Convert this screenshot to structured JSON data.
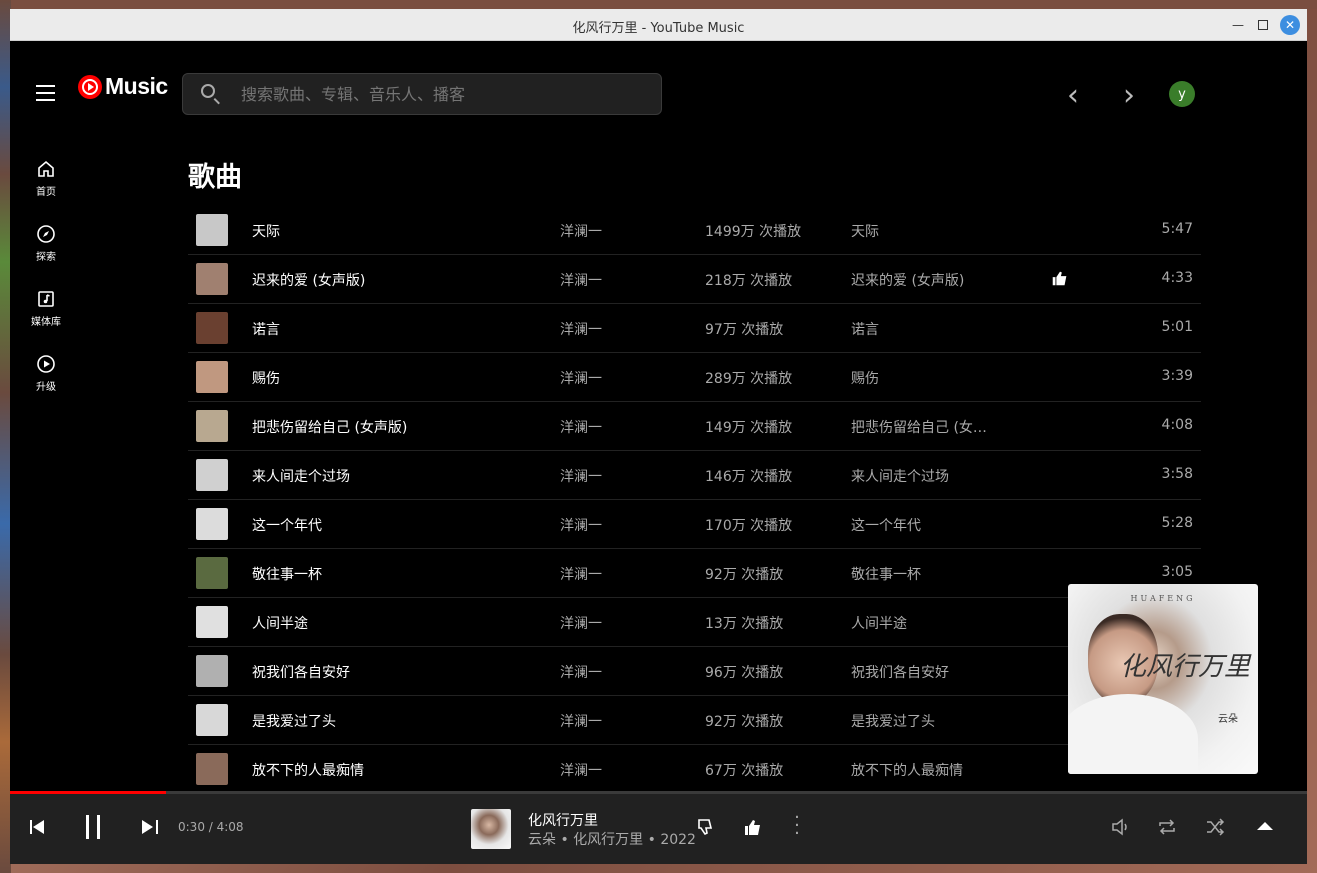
{
  "window": {
    "title": "化风行万里 - YouTube Music"
  },
  "header": {
    "logo_text": "Music",
    "search_placeholder": "搜索歌曲、专辑、音乐人、播客",
    "avatar_letter": "y"
  },
  "sidebar": {
    "items": [
      {
        "label": "首页",
        "icon": "home-icon"
      },
      {
        "label": "探索",
        "icon": "compass-icon"
      },
      {
        "label": "媒体库",
        "icon": "library-icon"
      },
      {
        "label": "升级",
        "icon": "upgrade-icon"
      }
    ]
  },
  "main": {
    "section_title": "歌曲",
    "songs": [
      {
        "title": "天际",
        "artist": "洋澜一",
        "plays": "1499万 次播放",
        "album": "天际",
        "duration": "5:47",
        "liked": false,
        "thumb": "#c8c8c8"
      },
      {
        "title": "迟来的爱 (女声版)",
        "artist": "洋澜一",
        "plays": "218万 次播放",
        "album": "迟来的爱 (女声版)",
        "duration": "4:33",
        "liked": true,
        "thumb": "#a08070"
      },
      {
        "title": "诺言",
        "artist": "洋澜一",
        "plays": "97万 次播放",
        "album": "诺言",
        "duration": "5:01",
        "liked": false,
        "thumb": "#6a4030"
      },
      {
        "title": "赐伤",
        "artist": "洋澜一",
        "plays": "289万 次播放",
        "album": "赐伤",
        "duration": "3:39",
        "liked": false,
        "thumb": "#c09880"
      },
      {
        "title": "把悲伤留给自己 (女声版)",
        "artist": "洋澜一",
        "plays": "149万 次播放",
        "album": "把悲伤留给自己 (女…",
        "duration": "4:08",
        "liked": false,
        "thumb": "#b8a890"
      },
      {
        "title": "来人间走个过场",
        "artist": "洋澜一",
        "plays": "146万 次播放",
        "album": "来人间走个过场",
        "duration": "3:58",
        "liked": false,
        "thumb": "#d0d0d0"
      },
      {
        "title": "这一个年代",
        "artist": "洋澜一",
        "plays": "170万 次播放",
        "album": "这一个年代",
        "duration": "5:28",
        "liked": false,
        "thumb": "#dcdcdc"
      },
      {
        "title": "敬往事一杯",
        "artist": "洋澜一",
        "plays": "92万 次播放",
        "album": "敬往事一杯",
        "duration": "3:05",
        "liked": false,
        "thumb": "#5a6a40"
      },
      {
        "title": "人间半途",
        "artist": "洋澜一",
        "plays": "13万 次播放",
        "album": "人间半途",
        "duration": "",
        "liked": false,
        "thumb": "#e0e0e0"
      },
      {
        "title": "祝我们各自安好",
        "artist": "洋澜一",
        "plays": "96万 次播放",
        "album": "祝我们各自安好",
        "duration": "",
        "liked": false,
        "thumb": "#b0b0b0"
      },
      {
        "title": "是我爱过了头",
        "artist": "洋澜一",
        "plays": "92万 次播放",
        "album": "是我爱过了头",
        "duration": "",
        "liked": false,
        "thumb": "#d8d8d8"
      },
      {
        "title": "放不下的人最痴情",
        "artist": "洋澜一",
        "plays": "67万 次播放",
        "album": "放不下的人最痴情",
        "duration": "",
        "liked": false,
        "thumb": "#8a6a5a"
      }
    ]
  },
  "mini_player": {
    "brand": "HUAFENG",
    "script_title": "化风行万里",
    "artist": "云朵"
  },
  "player": {
    "time": "0:30 / 4:08",
    "progress_fraction": 0.12,
    "title": "化风行万里",
    "subtitle": "云朵 • 化风行万里 • 2022",
    "accent": "#ff0000"
  }
}
